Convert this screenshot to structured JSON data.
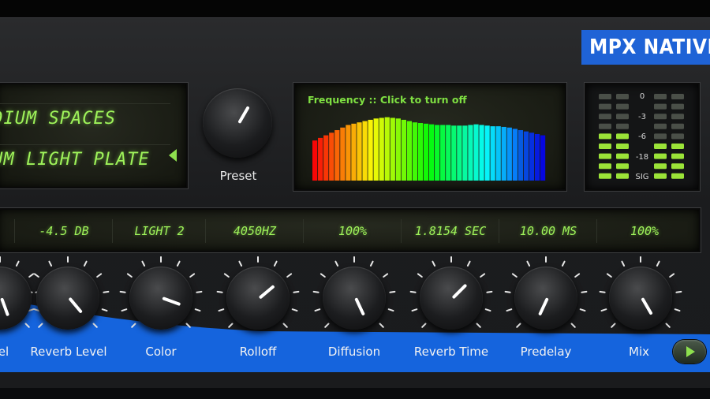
{
  "brand": {
    "label": "MPX NATIVE"
  },
  "preset_display": {
    "line1": "EDIUM SPACES",
    "line2": "IUM LIGHT PLATE"
  },
  "preset_knob": {
    "label": "Preset"
  },
  "frequency": {
    "title": "Frequency :: Click to turn off",
    "bar_levels": [
      0.62,
      0.66,
      0.7,
      0.74,
      0.78,
      0.82,
      0.86,
      0.88,
      0.9,
      0.92,
      0.94,
      0.96,
      0.97,
      0.98,
      0.97,
      0.96,
      0.94,
      0.92,
      0.9,
      0.89,
      0.88,
      0.87,
      0.86,
      0.86,
      0.86,
      0.85,
      0.85,
      0.85,
      0.86,
      0.87,
      0.86,
      0.85,
      0.84,
      0.84,
      0.83,
      0.82,
      0.8,
      0.78,
      0.76,
      0.74,
      0.72,
      0.7
    ]
  },
  "meter": {
    "scale": [
      "0",
      "-3",
      "-6",
      "-18",
      "SIG"
    ],
    "left_lit": 5,
    "right_lit": 4,
    "colors": {
      "lit": "#9be338",
      "unlit": "#4a4f48"
    }
  },
  "params": {
    "values": [
      "",
      "-4.5 DB",
      "LIGHT 2",
      "4050HZ",
      "100%",
      "1.8154 SEC",
      "10.00 MS",
      "100%"
    ]
  },
  "knobs": [
    {
      "label": "vel"
    },
    {
      "label": "Reverb Level"
    },
    {
      "label": "Color"
    },
    {
      "label": "Rolloff"
    },
    {
      "label": "Diffusion"
    },
    {
      "label": "Reverb Time"
    },
    {
      "label": "Predelay"
    },
    {
      "label": "Mix"
    }
  ],
  "colors": {
    "accent_blue": "#1564dd",
    "lcd_green": "#9ef25a"
  },
  "play_button": {
    "icon": "play-icon"
  }
}
